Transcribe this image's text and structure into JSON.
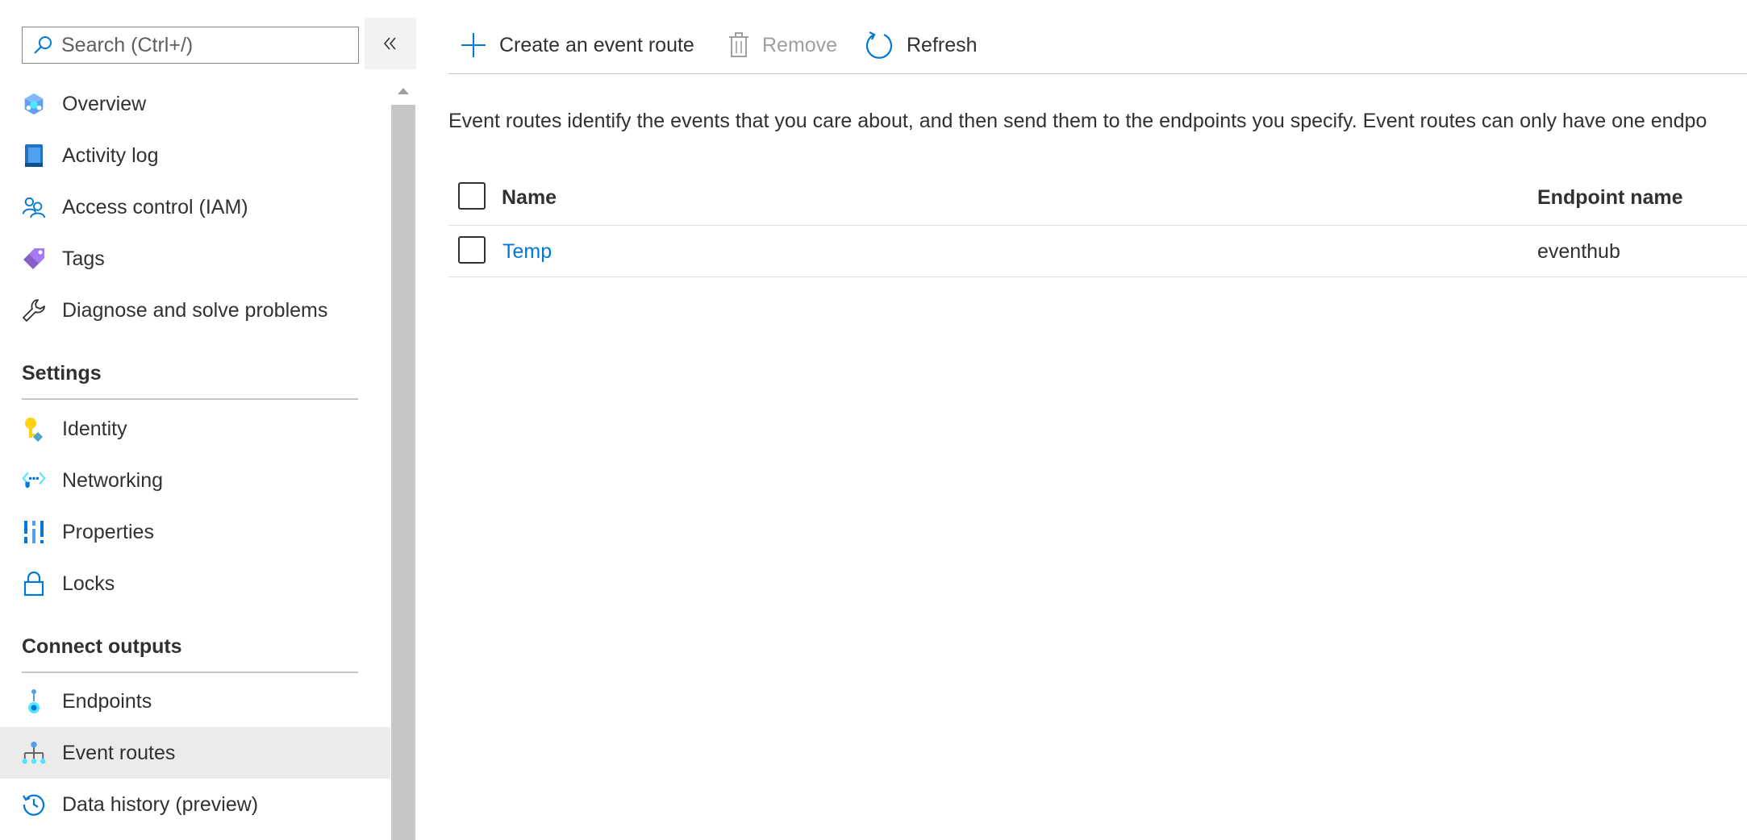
{
  "search": {
    "placeholder": "Search (Ctrl+/)"
  },
  "sidebar": {
    "items": [
      {
        "label": "Overview",
        "icon": "overview-icon"
      },
      {
        "label": "Activity log",
        "icon": "activity-log-icon"
      },
      {
        "label": "Access control (IAM)",
        "icon": "access-control-icon"
      },
      {
        "label": "Tags",
        "icon": "tag-icon"
      },
      {
        "label": "Diagnose and solve problems",
        "icon": "wrench-icon"
      }
    ],
    "settings": {
      "header": "Settings",
      "items": [
        {
          "label": "Identity",
          "icon": "key-icon"
        },
        {
          "label": "Networking",
          "icon": "networking-icon"
        },
        {
          "label": "Properties",
          "icon": "properties-icon"
        },
        {
          "label": "Locks",
          "icon": "lock-icon"
        }
      ]
    },
    "connect": {
      "header": "Connect outputs",
      "items": [
        {
          "label": "Endpoints",
          "icon": "endpoints-icon"
        },
        {
          "label": "Event routes",
          "icon": "event-routes-icon",
          "selected": true
        },
        {
          "label": "Data history (preview)",
          "icon": "history-icon"
        }
      ]
    }
  },
  "toolbar": {
    "create_label": "Create an event route",
    "remove_label": "Remove",
    "refresh_label": "Refresh"
  },
  "description": "Event routes identify the events that you care about, and then send them to the endpoints you specify. Event routes can only have one endpo",
  "table": {
    "columns": [
      "Name",
      "Endpoint name"
    ],
    "rows": [
      {
        "name": "Temp",
        "endpoint": "eventhub"
      }
    ]
  },
  "colors": {
    "accent": "#0078d4",
    "selected_bg": "#edebe9",
    "disabled_text": "#a19f9d"
  }
}
